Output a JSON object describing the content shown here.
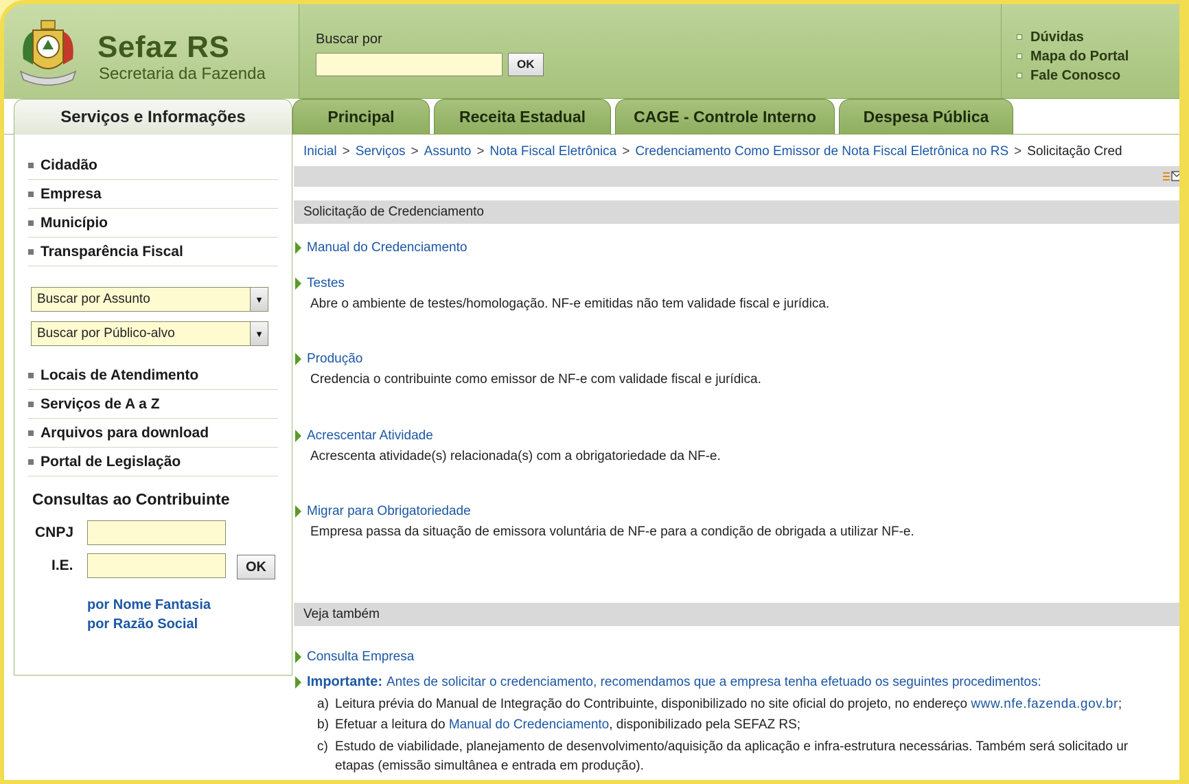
{
  "header": {
    "logo_title": "Sefaz RS",
    "logo_subtitle": "Secretaria da Fazenda",
    "search_label": "Buscar por",
    "search_value": "",
    "search_button": "OK",
    "top_links": [
      "Dúvidas",
      "Mapa do Portal",
      "Fale Conosco"
    ]
  },
  "tabs": {
    "side": "Serviços e Informações",
    "main": [
      "Principal",
      "Receita Estadual",
      "CAGE - Controle Interno",
      "Despesa Pública"
    ]
  },
  "sidebar": {
    "nav": [
      "Cidadão",
      "Empresa",
      "Município",
      "Transparência Fiscal"
    ],
    "select_assunto": "Buscar por Assunto",
    "select_publico": "Buscar por Público-alvo",
    "links": [
      "Locais de Atendimento",
      "Serviços de A a Z",
      "Arquivos para download",
      "Portal de Legislação"
    ],
    "consultas_title": "Consultas ao Contribuinte",
    "cnpj_label": "CNPJ",
    "ie_label": "I.E.",
    "ok_button": "OK",
    "by_fantasy": "por Nome Fantasia",
    "by_social": "por Razão Social"
  },
  "breadcrumb": [
    "Inicial",
    "Serviços",
    "Assunto",
    "Nota Fiscal Eletrônica",
    "Credenciamento Como Emissor de Nota Fiscal Eletrônica no RS",
    "Solicitação Cred"
  ],
  "content": {
    "section_title": "Solicitação de Credenciamento",
    "manual_link": "Manual do Credenciamento",
    "items": [
      {
        "title": "Testes",
        "desc": "Abre o ambiente de testes/homologação. NF-e emitidas não tem validade fiscal e jurídica."
      },
      {
        "title": "Produção",
        "desc": "Credencia o contribuinte como emissor de NF-e com validade fiscal e jurídica."
      },
      {
        "title": "Acrescentar Atividade",
        "desc": "Acrescenta atividade(s) relacionada(s) com a obrigatoriedade da NF-e."
      },
      {
        "title": "Migrar para Obrigatoriedade",
        "desc": "Empresa passa da situação de emissora voluntária de NF-e para a condição de obrigada a utilizar NF-e."
      }
    ],
    "see_also_title": "Veja também",
    "consulta_link": "Consulta Empresa",
    "important_label": "Importante:",
    "important_text": "Antes de solicitar o credenciamento, recomendamos que a empresa tenha efetuado os seguintes procedimentos:",
    "list": {
      "a_mark": "a)",
      "a_text": "Leitura prévia do Manual de Integração do Contribuinte, disponibilizado no site oficial do projeto, no endereço",
      "a_url": "www.nfe.fazenda.gov.br",
      "a_end": ";",
      "b_mark": "b)",
      "b_pre": "Efetuar a leitura do",
      "b_link": "Manual do Credenciamento",
      "b_post": ", disponibilizado pela SEFAZ RS;",
      "c_mark": "c)",
      "c_text": "Estudo de viabilidade, planejamento de desenvolvimento/aquisição da aplicação e infra-estrutura necessárias. Também será solicitado ur",
      "c_text2": "etapas (emissão simultânea e entrada em produção)."
    }
  },
  "colors": {
    "link": "#1c57a4",
    "header_green": "#a6c27b",
    "tab_green": "#8eae5f",
    "frame_yellow": "#f2dc4f",
    "input_yellow": "#fffbd0"
  }
}
